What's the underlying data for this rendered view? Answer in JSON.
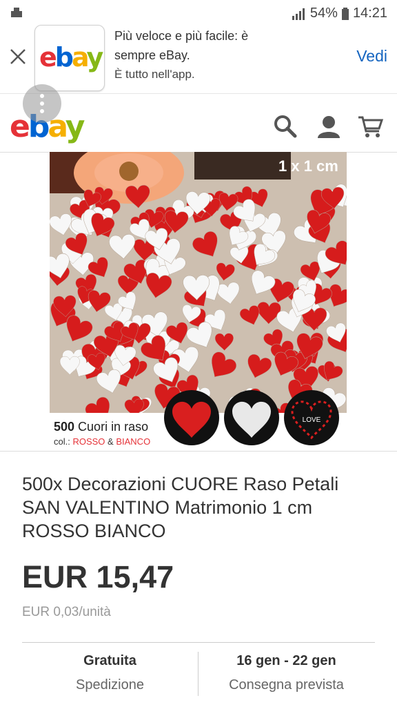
{
  "status_bar": {
    "battery": "54%",
    "time": "14:21"
  },
  "banner": {
    "line1": "Più veloce e più facile: è",
    "line2": "sempre eBay.",
    "line3": "È tutto nell'app.",
    "action": "Vedi"
  },
  "logo": {
    "e": "e",
    "b": "b",
    "a": "a",
    "y": "y"
  },
  "image": {
    "size_label": "1 x 1 cm",
    "caption_count": "500",
    "caption_rest": " Cuori in raso",
    "color_prefix": "col.: ",
    "color_red": "ROSSO",
    "color_amp": " & ",
    "color_white": "BIANCO",
    "love_text": "LOVE"
  },
  "product": {
    "title": "500x Decorazioni CUORE Raso Petali SAN VALENTINO Matrimonio 1 cm ROSSO BIANCO",
    "price": "EUR 15,47",
    "unit_price": "EUR 0,03/unità"
  },
  "shipping": {
    "value": "Gratuita",
    "label": "Spedizione"
  },
  "delivery": {
    "value": "16 gen - 22 gen",
    "label": "Consegna prevista"
  },
  "colors": {
    "accent": "#1565c0",
    "red": "#e53238",
    "blue": "#0064d2",
    "yellow": "#f5af02",
    "green": "#86b817"
  }
}
